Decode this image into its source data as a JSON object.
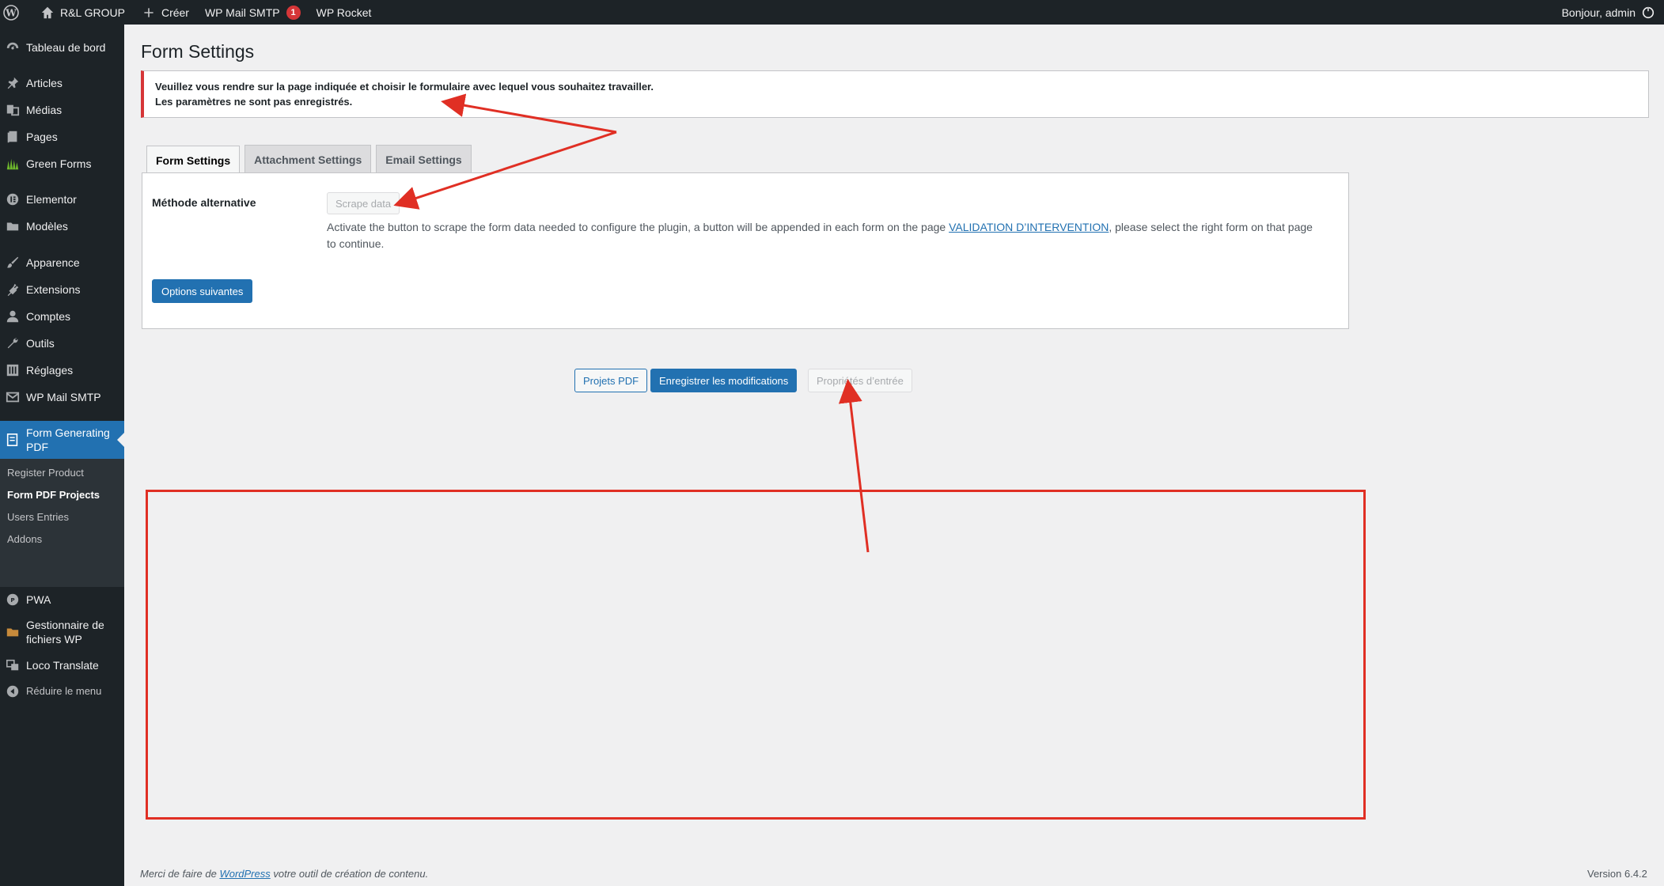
{
  "adminbar": {
    "site_name": "R&L GROUP",
    "new_label": "Créer",
    "smtp_label": "WP Mail SMTP",
    "smtp_badge": "1",
    "rocket_label": "WP Rocket",
    "greeting": "Bonjour, admin"
  },
  "sidebar": {
    "items": [
      {
        "label": "Tableau de bord",
        "icon": "dashboard-icon"
      },
      {
        "label": "Articles",
        "icon": "pin-icon"
      },
      {
        "label": "Médias",
        "icon": "media-icon"
      },
      {
        "label": "Pages",
        "icon": "page-icon"
      },
      {
        "label": "Green Forms",
        "icon": "grass-icon"
      },
      {
        "label": "Elementor",
        "icon": "elementor-icon"
      },
      {
        "label": "Modèles",
        "icon": "folder-icon"
      },
      {
        "label": "Apparence",
        "icon": "brush-icon"
      },
      {
        "label": "Extensions",
        "icon": "plugin-icon"
      },
      {
        "label": "Comptes",
        "icon": "user-icon"
      },
      {
        "label": "Outils",
        "icon": "wrench-icon"
      },
      {
        "label": "Réglages",
        "icon": "settings-icon"
      },
      {
        "label": "WP Mail SMTP",
        "icon": "mail-icon"
      },
      {
        "label_line1": "Form Generating",
        "label_line2": "PDF",
        "icon": "form-icon"
      },
      {
        "label": "PWA",
        "icon": "pwa-icon"
      },
      {
        "label_line1": "Gestionnaire de",
        "label_line2": "fichiers WP",
        "icon": "file-manager-icon"
      },
      {
        "label": "Loco Translate",
        "icon": "translate-icon"
      },
      {
        "label": "Réduire le menu",
        "icon": "collapse-icon"
      }
    ],
    "submenu": [
      "Register Product",
      "Form PDF Projects",
      "Users Entries",
      "Addons"
    ]
  },
  "page": {
    "title": "Form Settings",
    "notice_line1": "Veuillez vous rendre sur la page indiquée et choisir le formulaire avec lequel vous souhaitez travailler.",
    "notice_line2": "Les paramètres ne sont pas enregistrés.",
    "tabs": [
      "Form Settings",
      "Attachment Settings",
      "Email Settings"
    ],
    "field_label": "Méthode alternative",
    "scrape_button": "Scrape data",
    "desc_before": "Activate the button to scrape the form data needed to configure the plugin, a button will be appended in each form on the page ",
    "desc_link": "VALIDATION D’INTERVENTION",
    "desc_after": ", please select the right form on that page to continue.",
    "next_button": "Options suivantes",
    "btn_projets": "Projets PDF",
    "btn_save": "Enregistrer les modifications",
    "btn_props": "Propriétés d’entrée"
  },
  "footer": {
    "thanks_before": "Merci de faire de ",
    "thanks_link": "WordPress",
    "thanks_after": " votre outil de création de contenu.",
    "version": "Version 6.4.2"
  },
  "colors": {
    "annotation_red": "#e02f24",
    "wp_blue": "#2271b1",
    "admin_dark": "#1d2327",
    "notice_red": "#d63638"
  }
}
